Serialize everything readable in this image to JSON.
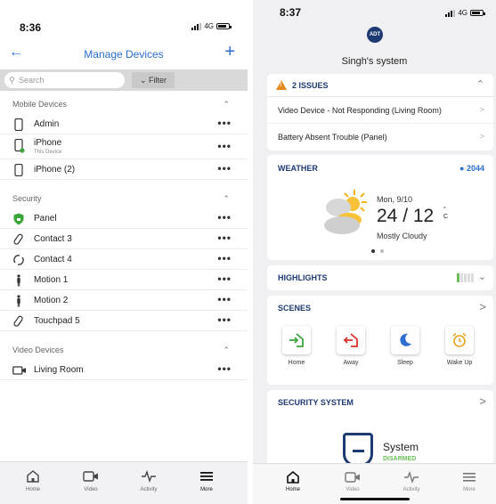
{
  "left": {
    "status_time": "8:36",
    "network": "4G",
    "title": "Manage Devices",
    "back_icon": "back-arrow-icon",
    "add_icon": "plus-icon",
    "search_placeholder": "Search",
    "filter_label": "Filter",
    "sections": [
      {
        "title": "Mobile Devices",
        "items": [
          {
            "label": "Admin",
            "sub": "",
            "icon": "phone-icon"
          },
          {
            "label": "iPhone",
            "sub": "This Device",
            "icon": "phone-icon"
          },
          {
            "label": "iPhone (2)",
            "sub": "",
            "icon": "phone-icon"
          }
        ]
      },
      {
        "title": "Security",
        "items": [
          {
            "label": "Panel",
            "icon": "shield-icon"
          },
          {
            "label": "Contact 3",
            "icon": "contact-sensor-icon"
          },
          {
            "label": "Contact 4",
            "icon": "contact-open-icon"
          },
          {
            "label": "Motion 1",
            "icon": "motion-sensor-icon"
          },
          {
            "label": "Motion 2",
            "icon": "motion-sensor-icon"
          },
          {
            "label": "Touchpad 5",
            "icon": "touchpad-icon"
          }
        ]
      },
      {
        "title": "Video Devices",
        "items": [
          {
            "label": "Living Room",
            "icon": "camera-icon"
          }
        ]
      }
    ],
    "more_glyph": "•••",
    "tabs": [
      {
        "label": "Home",
        "icon": "home-icon"
      },
      {
        "label": "Video",
        "icon": "camera-icon"
      },
      {
        "label": "Activity",
        "icon": "activity-icon"
      },
      {
        "label": "More",
        "icon": "menu-icon",
        "active": true
      }
    ]
  },
  "right": {
    "status_time": "8:37",
    "network": "4G",
    "logo_text": "ADT",
    "system_name": "Singh's system",
    "issues": {
      "title": "2 ISSUES",
      "rows": [
        "Video Device - Not Responding (Living Room)",
        "Battery Absent Trouble (Panel)"
      ]
    },
    "weather": {
      "title": "WEATHER",
      "location": "2044",
      "date": "Mon, 9/10",
      "temp": "24 / 12",
      "unit_top": "°",
      "unit_bottom": "C",
      "condition": "Mostly Cloudy"
    },
    "highlights": {
      "title": "HIGHLIGHTS"
    },
    "scenes": {
      "title": "SCENES",
      "items": [
        {
          "label": "Home",
          "icon": "home-scene-icon",
          "color": "#3aa63a"
        },
        {
          "label": "Away",
          "icon": "away-scene-icon",
          "color": "#d8312b"
        },
        {
          "label": "Sleep",
          "icon": "moon-icon",
          "color": "#2d6fd0"
        },
        {
          "label": "Wake Up",
          "icon": "alarm-clock-icon",
          "color": "#e9a21d"
        }
      ]
    },
    "security": {
      "title": "SECURITY SYSTEM",
      "system_label": "System",
      "state": "DISARMED"
    },
    "tabs": [
      {
        "label": "Home",
        "icon": "home-icon",
        "active": true
      },
      {
        "label": "Video",
        "icon": "camera-icon"
      },
      {
        "label": "Activity",
        "icon": "activity-icon"
      },
      {
        "label": "More",
        "icon": "menu-icon"
      }
    ]
  },
  "colors": {
    "brand_blue": "#1e3a72",
    "link_blue": "#2d6fd0",
    "warning_orange": "#e48a1e",
    "ok_green": "#6bbf59"
  }
}
